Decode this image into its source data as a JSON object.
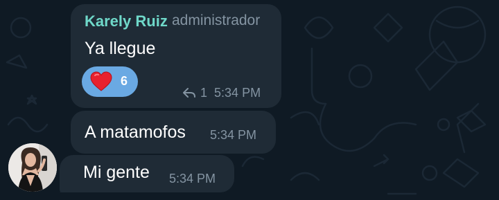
{
  "colors": {
    "background": "#0f1a24",
    "bubble": "#1f2b36",
    "sender_name": "#6fd8c9",
    "meta_text": "#8494a2",
    "reaction_bg": "#6aa9e3",
    "heart": "#e8212e"
  },
  "messages": [
    {
      "sender": "Karely Ruiz",
      "role": "administrador",
      "text": "Ya llegue",
      "reaction": {
        "icon": "heart-icon",
        "count": "6"
      },
      "reply_count": "1",
      "time": "5:34 PM"
    },
    {
      "text": "A matamofos",
      "time": "5:34 PM"
    },
    {
      "text": "Mi gente",
      "time": "5:34 PM"
    }
  ]
}
